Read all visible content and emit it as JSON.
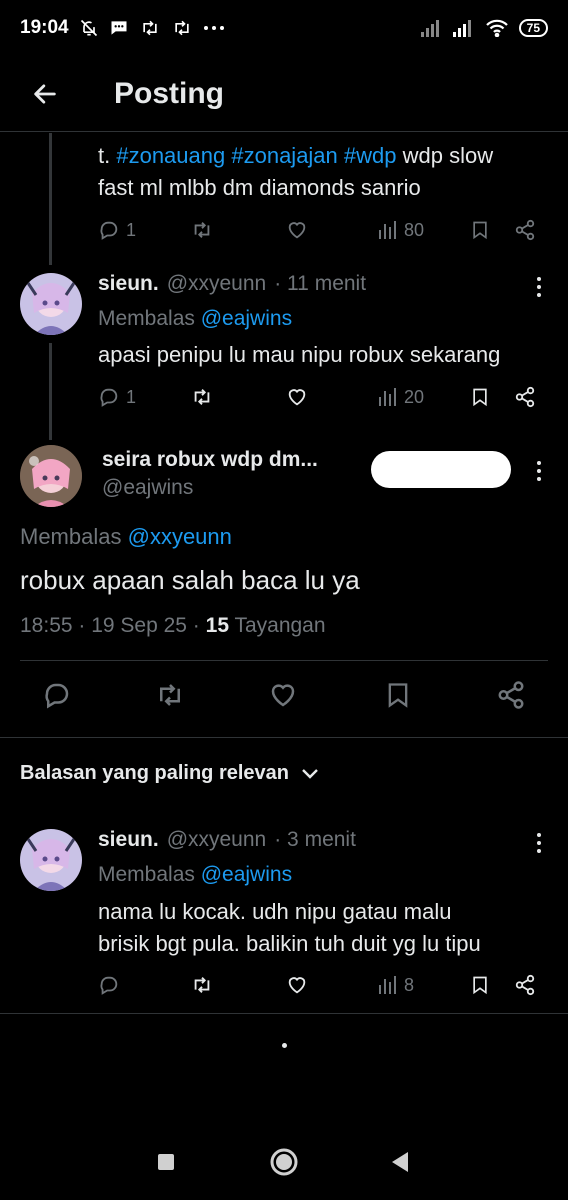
{
  "status_bar": {
    "time": "19:04",
    "battery": "75",
    "icons": [
      "bell-off-icon",
      "message-icon",
      "retweet-icon",
      "retweet-icon",
      "more-dots-icon",
      "signal-icon",
      "signal-icon",
      "wifi-icon",
      "battery-icon"
    ]
  },
  "header": {
    "title": "Posting",
    "back_icon": "arrow-left-icon"
  },
  "tweets": {
    "partial": {
      "text_prefix": "t. ",
      "hashtags": [
        "#zonauang",
        "#zonajajan",
        "#wdp"
      ],
      "text_line1_suffix": " wdp slow",
      "text_line2": "fast ml mlbb dm diamonds sanrio",
      "replies": "1",
      "views": "80"
    },
    "reply1": {
      "name": "sieun.",
      "handle": "@xxyeunn",
      "time": "· 11 menit",
      "reply_prefix": "Membalas",
      "reply_mention": "@eajwins",
      "text": "apasi penipu lu mau nipu robux sekarang",
      "replies": "1",
      "views": "20"
    },
    "main": {
      "name": "seira robux wdp dm...",
      "handle": "@eajwins",
      "reply_prefix": "Membalas",
      "reply_mention": "@xxyeunn",
      "text": "robux apaan salah baca lu ya",
      "time_date": "18:55 · 19 Sep 25 · ",
      "views_count": "15",
      "views_label": "Tayangan"
    },
    "reply2": {
      "name": "sieun.",
      "handle": "@xxyeunn",
      "time": "· 3 menit",
      "reply_prefix": "Membalas",
      "reply_mention": "@eajwins",
      "text_line1": "nama lu kocak. udh nipu gatau malu",
      "text_line2": "brisik bgt pula. balikin tuh duit yg lu tipu",
      "views": "8"
    }
  },
  "sort": {
    "label": "Balasan yang paling relevan",
    "icon": "chevron-down-icon"
  },
  "colors": {
    "background": "#000000",
    "text": "#e7e9ea",
    "secondary": "#71767b",
    "accent": "#1d9bf0",
    "divider": "#2f3336"
  }
}
